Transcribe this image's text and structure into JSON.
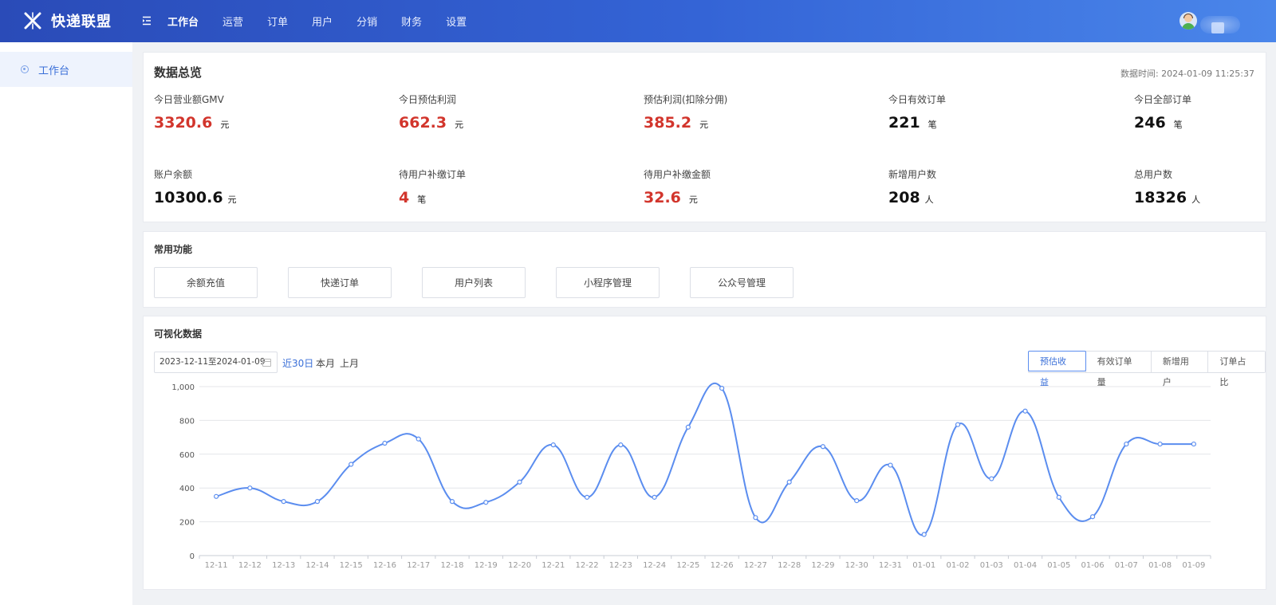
{
  "header": {
    "app_name": "快递联盟",
    "nav": [
      {
        "label": "工作台",
        "active": true
      },
      {
        "label": "运营",
        "active": false
      },
      {
        "label": "订单",
        "active": false
      },
      {
        "label": "用户",
        "active": false
      },
      {
        "label": "分销",
        "active": false
      },
      {
        "label": "财务",
        "active": false
      },
      {
        "label": "设置",
        "active": false
      }
    ]
  },
  "sidebar": {
    "items": [
      {
        "label": "工作台",
        "active": true
      }
    ]
  },
  "overview": {
    "title": "数据总览",
    "data_time": "数据时间: 2024-01-09 11:25:37",
    "stats": [
      {
        "label": "今日营业额GMV",
        "value": "3320.6",
        "unit": "元",
        "highlight": true
      },
      {
        "label": "今日预估利润",
        "value": "662.3",
        "unit": "元",
        "highlight": true
      },
      {
        "label": "预估利润(扣除分佣)",
        "value": "385.2",
        "unit": "元",
        "highlight": true
      },
      {
        "label": "今日有效订单",
        "value": "221",
        "unit": "笔",
        "highlight": false
      },
      {
        "label": "今日全部订单",
        "value": "246",
        "unit": "笔",
        "highlight": false
      },
      {
        "label": "账户余额",
        "value": "10300.6",
        "unit": "元",
        "highlight": false
      },
      {
        "label": "待用户补缴订单",
        "value": "4",
        "unit": "笔",
        "highlight": true
      },
      {
        "label": "待用户补缴金额",
        "value": "32.6",
        "unit": "元",
        "highlight": true
      },
      {
        "label": "新增用户数",
        "value": "208",
        "unit": "人",
        "highlight": false
      },
      {
        "label": "总用户数",
        "value": "18326",
        "unit": "人",
        "highlight": false
      }
    ]
  },
  "functions": {
    "title": "常用功能",
    "buttons": [
      "余额充值",
      "快递订单",
      "用户列表",
      "小程序管理",
      "公众号管理"
    ]
  },
  "visual": {
    "title": "可视化数据",
    "date_range": "2023-12-11至2024-01-09",
    "quick_ranges": [
      {
        "label": "近30日",
        "active": true
      },
      {
        "label": "本月",
        "active": false
      },
      {
        "label": "上月",
        "active": false
      }
    ],
    "tabs": [
      {
        "label": "预估收益",
        "active": true
      },
      {
        "label": "有效订单量",
        "active": false
      },
      {
        "label": "新增用户",
        "active": false
      },
      {
        "label": "订单占比",
        "active": false
      }
    ]
  },
  "colors": {
    "accent": "#3a6fd8",
    "highlight_red": "#d2352c",
    "line": "#5b8def",
    "header_start": "#2a4bb8",
    "header_end": "#4a86ea"
  },
  "chart_data": {
    "type": "line",
    "smooth": true,
    "categories": [
      "12-11",
      "12-12",
      "12-13",
      "12-14",
      "12-15",
      "12-16",
      "12-17",
      "12-18",
      "12-19",
      "12-20",
      "12-21",
      "12-22",
      "12-23",
      "12-24",
      "12-25",
      "12-26",
      "12-27",
      "12-28",
      "12-29",
      "12-30",
      "12-31",
      "01-01",
      "01-02",
      "01-03",
      "01-04",
      "01-05",
      "01-06",
      "01-07",
      "01-08",
      "01-09"
    ],
    "series": [
      {
        "values": [
          350,
          400,
          320,
          320,
          540,
          665,
          690,
          320,
          315,
          435,
          655,
          345,
          655,
          345,
          760,
          990,
          225,
          435,
          645,
          325,
          535,
          125,
          775,
          455,
          855,
          345,
          230,
          660,
          660,
          660
        ]
      }
    ],
    "yticks": [
      0,
      200,
      400,
      600,
      800,
      1000
    ],
    "ytick_labels": [
      "0",
      "200",
      "400",
      "600",
      "800",
      "1,000"
    ],
    "ylim": [
      0,
      1000
    ],
    "grid": true,
    "legend": "none"
  }
}
